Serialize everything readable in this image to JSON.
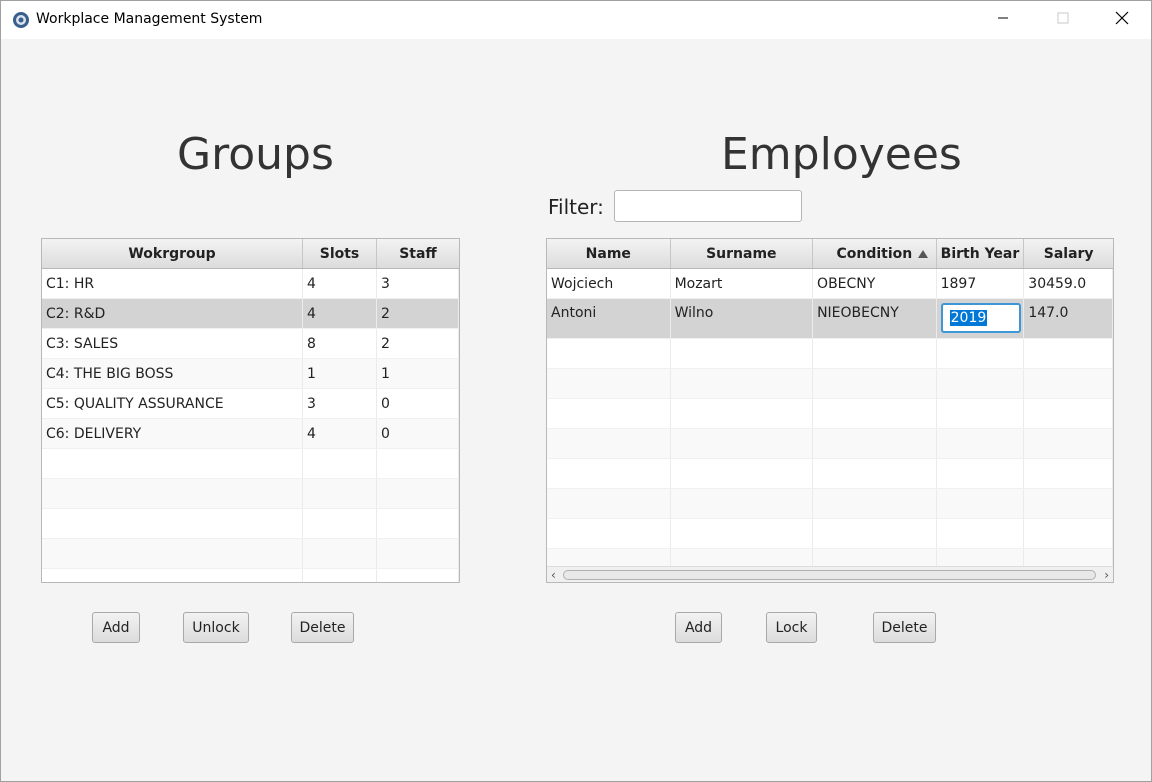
{
  "window": {
    "title": "Workplace Management System"
  },
  "groups": {
    "heading": "Groups",
    "columns": [
      "Wokrgroup",
      "Slots",
      "Staff"
    ],
    "rows": [
      [
        "C1: HR",
        "4",
        "3"
      ],
      [
        "C2: R&D",
        "4",
        "2"
      ],
      [
        "C3: SALES",
        "8",
        "2"
      ],
      [
        "C4: THE BIG BOSS",
        "1",
        "1"
      ],
      [
        "C5: QUALITY ASSURANCE",
        "3",
        "0"
      ],
      [
        "C6: DELIVERY",
        "4",
        "0"
      ]
    ],
    "buttons": {
      "add": "Add",
      "unlock": "Unlock",
      "delete": "Delete"
    }
  },
  "employees": {
    "heading": "Employees",
    "filter_label": "Filter:",
    "filter_value": "",
    "columns": [
      "Name",
      "Surname",
      "Condition",
      "Birth Year",
      "Salary"
    ],
    "sorted_column": "Condition",
    "rows": [
      [
        "Wojciech",
        "Mozart",
        "OBECNY",
        "1897",
        "30459.0"
      ],
      [
        "Antoni",
        "Wilno",
        "NIEOBECNY",
        "2019",
        "147.0"
      ]
    ],
    "editing_value": "2019",
    "buttons": {
      "add": "Add",
      "lock": "Lock",
      "delete": "Delete"
    }
  },
  "icons": [
    "app-gear-icon",
    "minimize-icon",
    "maximize-icon",
    "close-icon",
    "sort-ascending-icon",
    "scroll-left-icon",
    "scroll-right-icon"
  ]
}
